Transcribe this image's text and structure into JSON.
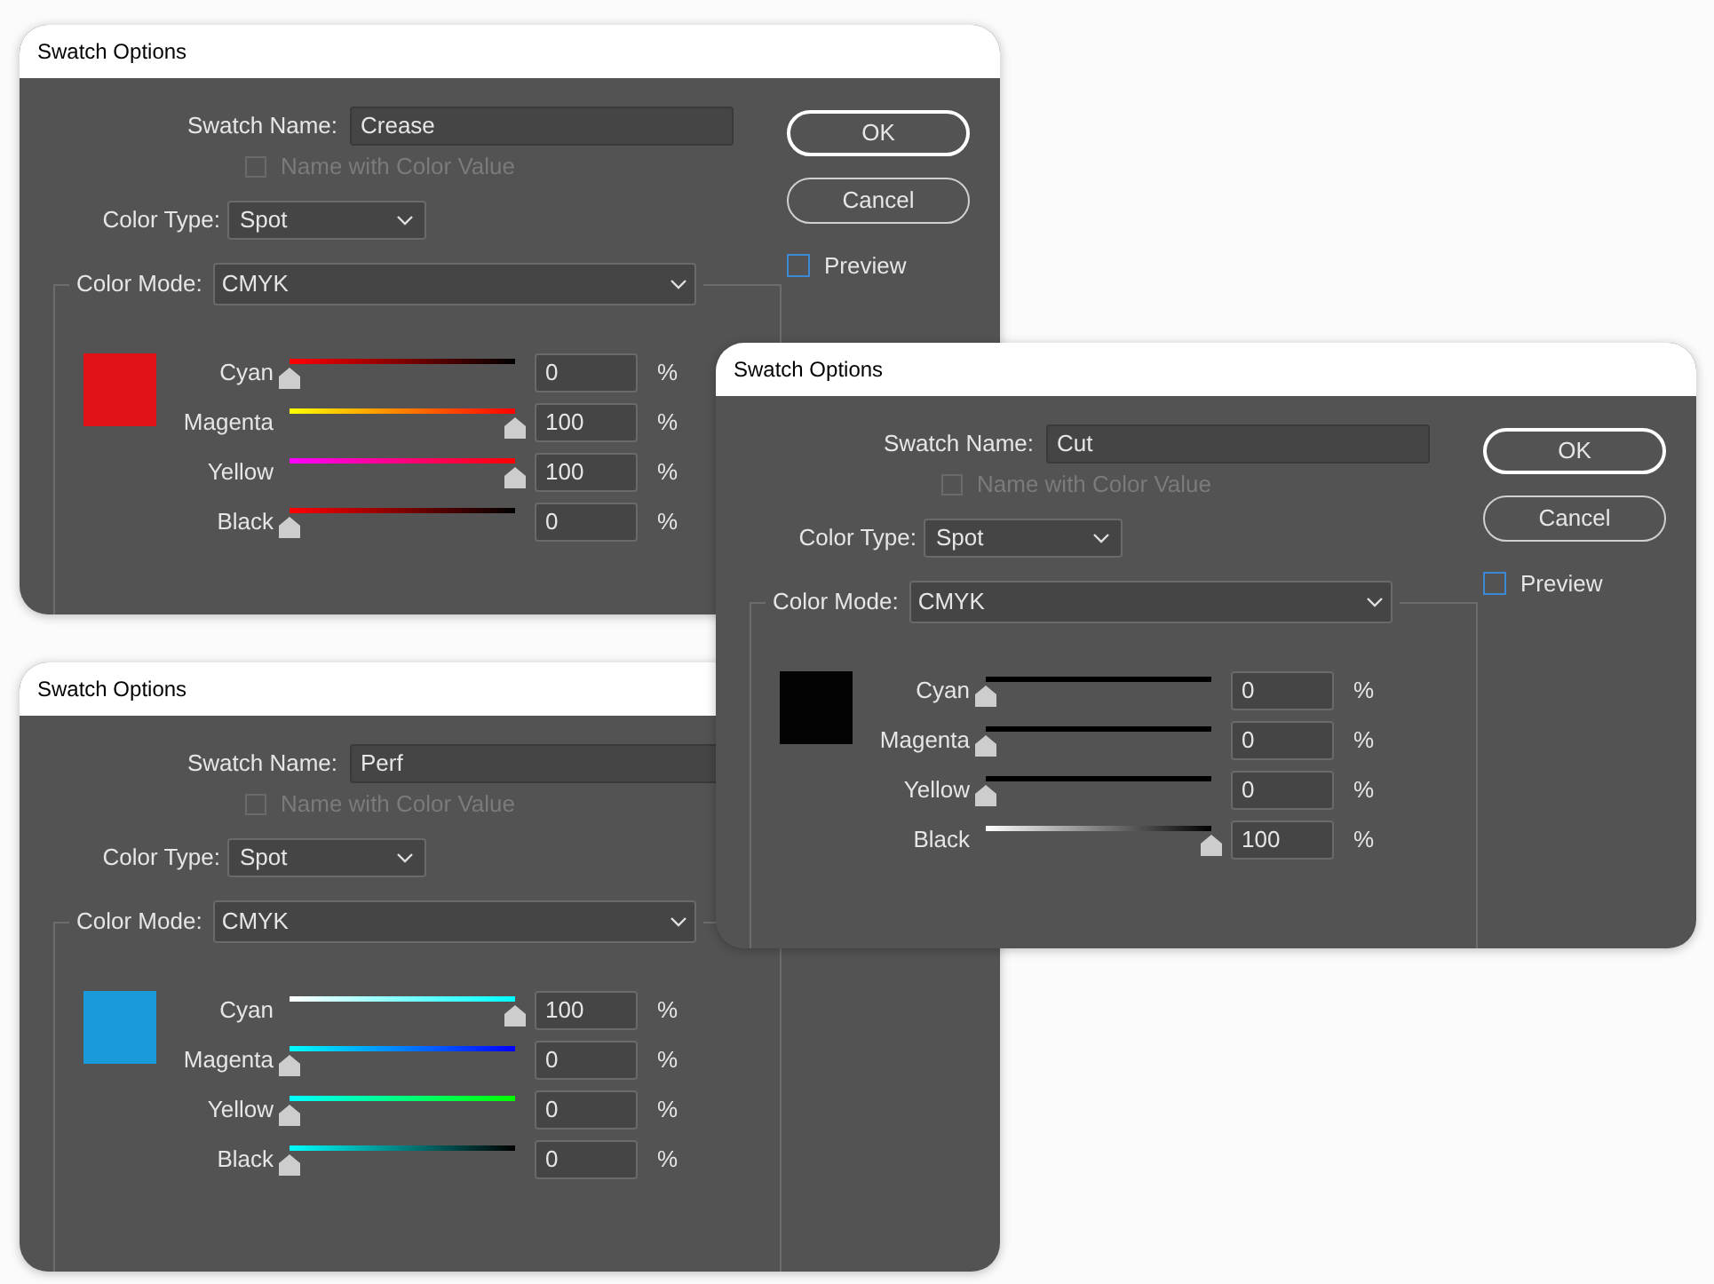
{
  "windows": [
    {
      "title": "Swatch Options",
      "name_label": "Swatch Name:",
      "name_value": "Crease",
      "name_with_color_value": {
        "label": "Name with Color Value",
        "checked": false,
        "disabled": true
      },
      "color_type_label": "Color Type:",
      "color_type": "Spot",
      "buttons": [
        {
          "label": "OK",
          "default": true
        },
        {
          "label": "Cancel",
          "default": false
        }
      ],
      "preview": {
        "label": "Preview",
        "checked": false
      },
      "color_mode_label": "Color Mode:",
      "color_mode": "CMYK",
      "swatch": {
        "color": "#e1111a"
      },
      "channels": [
        {
          "name": "Cyan",
          "level": 0,
          "value": "0",
          "unit": "%"
        },
        {
          "name": "Magenta",
          "level": 1,
          "value": "100",
          "unit": "%"
        },
        {
          "name": "Yellow",
          "level": 1,
          "value": "100",
          "unit": "%"
        },
        {
          "name": "Black",
          "level": 0,
          "value": "0",
          "unit": "%"
        }
      ]
    },
    {
      "title": "Swatch Options",
      "name_label": "Swatch Name:",
      "name_value": "Perf",
      "name_with_color_value": {
        "label": "Name with Color Value",
        "checked": false,
        "disabled": true
      },
      "color_type_label": "Color Type:",
      "color_type": "Spot",
      "color_mode_label": "Color Mode:",
      "color_mode": "CMYK",
      "swatch": {
        "color": "#1a9ad8"
      },
      "channels": [
        {
          "name": "Cyan",
          "level": 1,
          "value": "100",
          "unit": "%"
        },
        {
          "name": "Magenta",
          "level": 0,
          "value": "0",
          "unit": "%"
        },
        {
          "name": "Yellow",
          "level": 0,
          "value": "0",
          "unit": "%"
        },
        {
          "name": "Black",
          "level": 0,
          "value": "0",
          "unit": "%"
        }
      ]
    },
    {
      "title": "Swatch Options",
      "name_label": "Swatch Name:",
      "name_value": "Cut",
      "name_with_color_value": {
        "label": "Name with Color Value",
        "checked": false,
        "disabled": true
      },
      "color_type_label": "Color Type:",
      "color_type": "Spot",
      "buttons": [
        {
          "label": "OK",
          "default": true
        },
        {
          "label": "Cancel",
          "default": false
        }
      ],
      "preview": {
        "label": "Preview",
        "checked": false
      },
      "color_mode_label": "Color Mode:",
      "color_mode": "CMYK",
      "swatch": {
        "color": "#030303"
      },
      "channels": [
        {
          "name": "Cyan",
          "level": 0,
          "value": "0",
          "unit": "%"
        },
        {
          "name": "Magenta",
          "level": 0,
          "value": "0",
          "unit": "%"
        },
        {
          "name": "Yellow",
          "level": 0,
          "value": "0",
          "unit": "%"
        },
        {
          "name": "Black",
          "level": 1,
          "value": "100",
          "unit": "%"
        }
      ]
    }
  ]
}
